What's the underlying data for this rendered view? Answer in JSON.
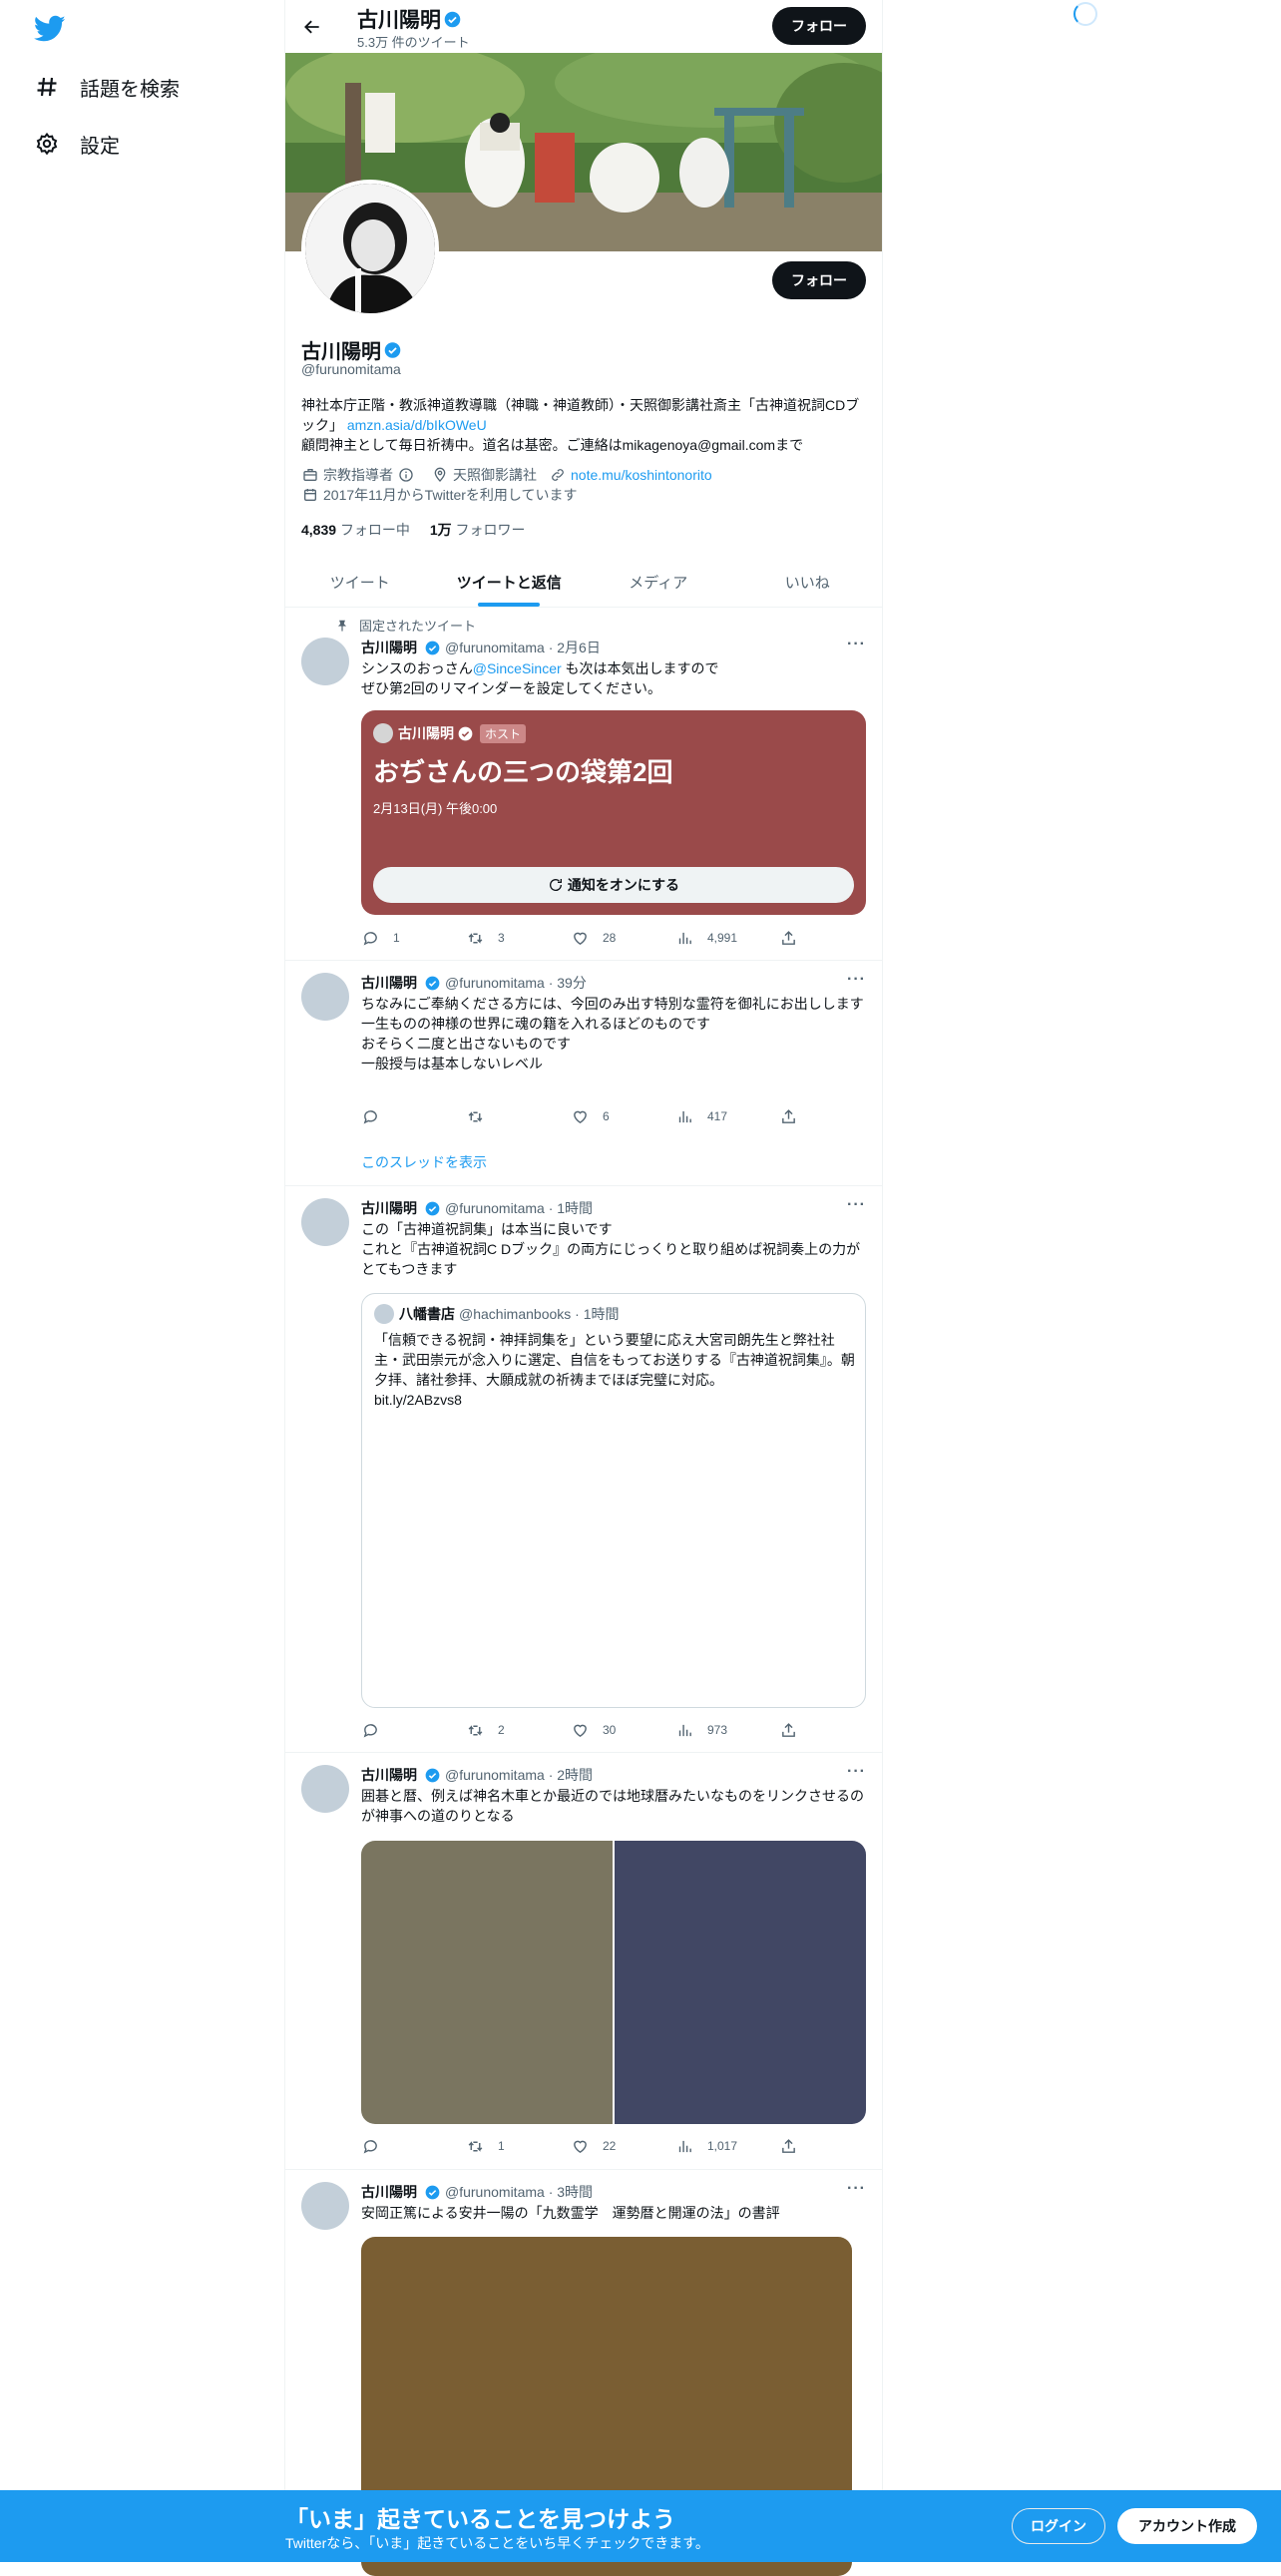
{
  "nav": {
    "explore_label": "話題を検索",
    "settings_label": "設定"
  },
  "profile": {
    "name": "古川陽明",
    "tweet_count": "5.3万 件のツイート",
    "follow_label": "フォロー",
    "handle": "@furunomitama",
    "bio_line1": "神社本庁正階・教派神道教導職（神職・神道教師）・天照御影講社斎主「古神道祝詞CDブック」",
    "bio_link": "amzn.asia/d/bIkOWeU",
    "bio_line2": "顧問神主として毎日祈祷中。道名は基密。ご連絡はmikagenoya@gmail.comまで",
    "category": "宗教指導者",
    "location": "天照御影講社",
    "website": "note.mu/koshintonorito",
    "joined": "2017年11月からTwitterを利用しています",
    "following_count": "4,839",
    "following_label": "フォロー中",
    "followers_count": "1万",
    "followers_label": "フォロワー"
  },
  "tabs": [
    {
      "label": "ツイート"
    },
    {
      "label": "ツイートと返信"
    },
    {
      "label": "メディア"
    },
    {
      "label": "いいね"
    }
  ],
  "tweets": [
    {
      "pinned_label": "固定されたツイート",
      "name": "古川陽明",
      "handle": "@furunomitama",
      "time": "2月6日",
      "text_pre": "シンスのおっさん",
      "mention": "@SinceSincer",
      "text_post": " も次は本気出しますので",
      "text_line2": "ぜひ第2回のリマインダーを設定してください。",
      "space": {
        "host_name": "古川陽明",
        "host_badge": "ホスト",
        "title": "おぢさんの三つの袋第2回",
        "date": "2月13日(月) 午後0:00",
        "button": "通知をオンにする"
      },
      "replies": "1",
      "retweets": "3",
      "likes": "28",
      "views": "4,991"
    },
    {
      "name": "古川陽明",
      "handle": "@furunomitama",
      "time": "39分",
      "lines": [
        "ちなみにご奉納くださる方には、今回のみ出す特別な霊符を御礼にお出しします",
        "一生ものの神様の世界に魂の籍を入れるほどのものです",
        "おそらく二度と出さないものです",
        "一般授与は基本しないレベル"
      ],
      "replies": "",
      "retweets": "",
      "likes": "6",
      "views": "417",
      "thread_link": "このスレッドを表示"
    },
    {
      "name": "古川陽明",
      "handle": "@furunomitama",
      "time": "1時間",
      "lines": [
        "この「古神道祝詞集」は本当に良いです",
        "これと『古神道祝詞C Dブック』の両方にじっくりと取り組めば祝詞奏上の力がとてもつきます"
      ],
      "quote": {
        "name": "八幡書店",
        "handle": "@hachimanbooks",
        "time": "1時間",
        "text": "「信頼できる祝詞・神拝詞集を」という要望に応え大宮司朗先生と弊社社主・武田崇元が念入りに選定、自信をもってお送りする『古神道祝詞集』。朝夕拝、諸社参拝、大願成就の祈祷までほぼ完璧に対応。",
        "link": "bit.ly/2ABzvs8"
      },
      "replies": "",
      "retweets": "2",
      "likes": "30",
      "views": "973"
    },
    {
      "name": "古川陽明",
      "handle": "@furunomitama",
      "time": "2時間",
      "lines": [
        "囲碁と暦、例えば神名木車とか最近のでは地球暦みたいなものをリンクさせるのが神事への道のりとなる"
      ],
      "media_colors": [
        "#7a7560",
        "#414764"
      ],
      "replies": "",
      "retweets": "1",
      "likes": "22",
      "views": "1,017"
    },
    {
      "name": "古川陽明",
      "handle": "@furunomitama",
      "time": "3時間",
      "lines": [
        "安岡正篤による安井一陽の「九数霊学　運勢暦と開運の法」の書評"
      ],
      "media_colors": [
        "#7a5e33"
      ]
    }
  ],
  "cta": {
    "title": "「いま」起きていることを見つけよう",
    "subtitle": "Twitterなら、「いま」起きていることをいち早くチェックできます。",
    "login": "ログイン",
    "signup": "アカウント作成"
  },
  "colors": {
    "accent": "#1d9bf0",
    "space_card": "#9a4a4a"
  }
}
